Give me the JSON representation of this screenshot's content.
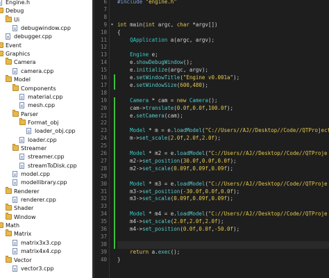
{
  "tree": {
    "items": [
      {
        "label": "Engine.h",
        "kind": "file"
      },
      {
        "label": "Debug",
        "kind": "folder"
      },
      {
        "label": "Ui",
        "kind": "folder"
      },
      {
        "label": "debugwindow.cpp",
        "kind": "file"
      },
      {
        "label": "debugger.cpp",
        "kind": "file"
      },
      {
        "label": "Event",
        "kind": "folder"
      },
      {
        "label": "Graphics",
        "kind": "folder"
      },
      {
        "label": "Camera",
        "kind": "folder"
      },
      {
        "label": "camera.cpp",
        "kind": "file"
      },
      {
        "label": "Model",
        "kind": "folder"
      },
      {
        "label": "Components",
        "kind": "folder"
      },
      {
        "label": "material.cpp",
        "kind": "file"
      },
      {
        "label": "mesh.cpp",
        "kind": "file"
      },
      {
        "label": "Parser",
        "kind": "folder"
      },
      {
        "label": "Format_obj",
        "kind": "folder"
      },
      {
        "label": "loader_obj.cpp",
        "kind": "file"
      },
      {
        "label": "loader.cpp",
        "kind": "file"
      },
      {
        "label": "Streamer",
        "kind": "folder"
      },
      {
        "label": "streamer.cpp",
        "kind": "file"
      },
      {
        "label": "streamToDisk.cpp",
        "kind": "file"
      },
      {
        "label": "model.cpp",
        "kind": "file"
      },
      {
        "label": "modellibrary.cpp",
        "kind": "file"
      },
      {
        "label": "Renderer",
        "kind": "folder"
      },
      {
        "label": "renderer.cpp",
        "kind": "file"
      },
      {
        "label": "Shader",
        "kind": "folder"
      },
      {
        "label": "Window",
        "kind": "folder"
      },
      {
        "label": "Math",
        "kind": "folder"
      },
      {
        "label": "Matrix",
        "kind": "folder"
      },
      {
        "label": "matrix3x3.cpp",
        "kind": "file"
      },
      {
        "label": "matrix4x4.cpp",
        "kind": "file"
      },
      {
        "label": "Vector",
        "kind": "folder"
      },
      {
        "label": "vector3.cpp",
        "kind": "file"
      }
    ]
  },
  "editor": {
    "line_numbers": [
      "6",
      "7",
      "8",
      "9",
      "10",
      "11",
      "12",
      "13",
      "14",
      "15",
      "16",
      "17",
      "18",
      "19",
      "20",
      "21",
      "22",
      "23",
      "24",
      "25",
      "26",
      "27",
      "28",
      "29",
      "30",
      "31",
      "32",
      "33",
      "34",
      "35",
      "36",
      "37",
      "38",
      "39",
      "40"
    ],
    "fold_marker": "▾",
    "lines": [
      [
        {
          "t": "#include ",
          "c": "pp"
        },
        {
          "t": "\"engine.h\"",
          "c": "str"
        }
      ],
      [],
      [],
      [
        {
          "t": "int ",
          "c": "kw"
        },
        {
          "t": "main(",
          "c": "id"
        },
        {
          "t": "int ",
          "c": "kw"
        },
        {
          "t": "argc, ",
          "c": "id"
        },
        {
          "t": "char ",
          "c": "kw"
        },
        {
          "t": "*argv[])",
          "c": "id"
        }
      ],
      [
        {
          "t": "{",
          "c": "id"
        }
      ],
      [
        {
          "t": "    ",
          "c": "id"
        },
        {
          "t": "QApplication",
          "c": "ty"
        },
        {
          "t": " a(argc, argv);",
          "c": "id"
        }
      ],
      [],
      [
        {
          "t": "    ",
          "c": "id"
        },
        {
          "t": "Engine",
          "c": "ty"
        },
        {
          "t": " e;",
          "c": "id"
        }
      ],
      [
        {
          "t": "    e.",
          "c": "id"
        },
        {
          "t": "showDebugWindow",
          "c": "fn"
        },
        {
          "t": "();",
          "c": "id"
        }
      ],
      [
        {
          "t": "    e.",
          "c": "id"
        },
        {
          "t": "initialize",
          "c": "fn"
        },
        {
          "t": "(argc, argv);",
          "c": "id"
        }
      ],
      [
        {
          "t": "    e.",
          "c": "id"
        },
        {
          "t": "setWindowTitle",
          "c": "fn"
        },
        {
          "t": "(",
          "c": "id"
        },
        {
          "t": "\"Engine v0.001a\"",
          "c": "str"
        },
        {
          "t": ");",
          "c": "id"
        }
      ],
      [
        {
          "t": "    e.",
          "c": "id"
        },
        {
          "t": "setWindowSize",
          "c": "fn"
        },
        {
          "t": "(",
          "c": "id"
        },
        {
          "t": "600",
          "c": "num"
        },
        {
          "t": ",",
          "c": "id"
        },
        {
          "t": "480",
          "c": "num"
        },
        {
          "t": ");",
          "c": "id"
        }
      ],
      [],
      [
        {
          "t": "    ",
          "c": "id"
        },
        {
          "t": "Camera",
          "c": "ty"
        },
        {
          "t": " * cam = ",
          "c": "id"
        },
        {
          "t": "new ",
          "c": "kw"
        },
        {
          "t": "Camera",
          "c": "ty"
        },
        {
          "t": "();",
          "c": "id"
        }
      ],
      [
        {
          "t": "    cam->",
          "c": "id"
        },
        {
          "t": "translate",
          "c": "fn"
        },
        {
          "t": "(",
          "c": "id"
        },
        {
          "t": "0.0f",
          "c": "num"
        },
        {
          "t": ",",
          "c": "id"
        },
        {
          "t": "0.0f",
          "c": "num"
        },
        {
          "t": ",",
          "c": "id"
        },
        {
          "t": "100.0f",
          "c": "num"
        },
        {
          "t": ");",
          "c": "id"
        }
      ],
      [
        {
          "t": "    e.",
          "c": "id"
        },
        {
          "t": "setCamera",
          "c": "fn"
        },
        {
          "t": "(cam);",
          "c": "id"
        }
      ],
      [],
      [
        {
          "t": "    ",
          "c": "id"
        },
        {
          "t": "Model",
          "c": "ty"
        },
        {
          "t": " * m = e.",
          "c": "id"
        },
        {
          "t": "loadModel",
          "c": "fn"
        },
        {
          "t": "(",
          "c": "id"
        },
        {
          "t": "\"C://Users//AJ//Desktop//Code//QTProjects",
          "c": "str"
        }
      ],
      [
        {
          "t": "    m->",
          "c": "id"
        },
        {
          "t": "set_scale",
          "c": "fn"
        },
        {
          "t": "(",
          "c": "id"
        },
        {
          "t": "2.0f",
          "c": "num"
        },
        {
          "t": ",",
          "c": "id"
        },
        {
          "t": "2.0f",
          "c": "num"
        },
        {
          "t": ",",
          "c": "id"
        },
        {
          "t": "2.0f",
          "c": "num"
        },
        {
          "t": ");",
          "c": "id"
        }
      ],
      [],
      [
        {
          "t": "    ",
          "c": "id"
        },
        {
          "t": "Model",
          "c": "ty"
        },
        {
          "t": " * m2 = e.",
          "c": "id"
        },
        {
          "t": "loadModel",
          "c": "fn"
        },
        {
          "t": "(",
          "c": "id"
        },
        {
          "t": "\"C://Users//AJ//Desktop//Code//QTProje",
          "c": "str"
        }
      ],
      [
        {
          "t": "    m2->",
          "c": "id"
        },
        {
          "t": "set_position",
          "c": "fn"
        },
        {
          "t": "(",
          "c": "id"
        },
        {
          "t": "30.0f",
          "c": "num"
        },
        {
          "t": ",",
          "c": "id"
        },
        {
          "t": "0.0f",
          "c": "num"
        },
        {
          "t": ",",
          "c": "id"
        },
        {
          "t": "0.0f",
          "c": "num"
        },
        {
          "t": ");",
          "c": "id"
        }
      ],
      [
        {
          "t": "    m2->",
          "c": "id"
        },
        {
          "t": "set_scale",
          "c": "fn"
        },
        {
          "t": "(",
          "c": "id"
        },
        {
          "t": "0.09f",
          "c": "num"
        },
        {
          "t": ",",
          "c": "id"
        },
        {
          "t": "0.09f",
          "c": "num"
        },
        {
          "t": ",",
          "c": "id"
        },
        {
          "t": "0.09f",
          "c": "num"
        },
        {
          "t": ");",
          "c": "id"
        }
      ],
      [],
      [
        {
          "t": "    ",
          "c": "id"
        },
        {
          "t": "Model",
          "c": "ty"
        },
        {
          "t": " * m3 = e.",
          "c": "id"
        },
        {
          "t": "loadModel",
          "c": "fn"
        },
        {
          "t": "(",
          "c": "id"
        },
        {
          "t": "\"C://Users//AJ//Desktop//Code//QTProje",
          "c": "str"
        }
      ],
      [
        {
          "t": "    m3->",
          "c": "id"
        },
        {
          "t": "set_position",
          "c": "fn"
        },
        {
          "t": "(",
          "c": "id"
        },
        {
          "t": "-30.0f",
          "c": "num"
        },
        {
          "t": ",",
          "c": "id"
        },
        {
          "t": "0.0f",
          "c": "num"
        },
        {
          "t": ",",
          "c": "id"
        },
        {
          "t": "0.0f",
          "c": "num"
        },
        {
          "t": ");",
          "c": "id"
        }
      ],
      [
        {
          "t": "    m3->",
          "c": "id"
        },
        {
          "t": "set_scale",
          "c": "fn"
        },
        {
          "t": "(",
          "c": "id"
        },
        {
          "t": "0.09f",
          "c": "num"
        },
        {
          "t": ",",
          "c": "id"
        },
        {
          "t": "0.09f",
          "c": "num"
        },
        {
          "t": ",",
          "c": "id"
        },
        {
          "t": "0.09f",
          "c": "num"
        },
        {
          "t": ");",
          "c": "id"
        }
      ],
      [],
      [
        {
          "t": "    ",
          "c": "id"
        },
        {
          "t": "Model",
          "c": "ty"
        },
        {
          "t": " * m4 = e.",
          "c": "id"
        },
        {
          "t": "loadModel",
          "c": "fn"
        },
        {
          "t": "(",
          "c": "id"
        },
        {
          "t": "\"C://Users//AJ//Desktop//Code//QTProje",
          "c": "str"
        }
      ],
      [
        {
          "t": "    m4->",
          "c": "id"
        },
        {
          "t": "set_scale",
          "c": "fn"
        },
        {
          "t": "(",
          "c": "id"
        },
        {
          "t": "2.0f",
          "c": "num"
        },
        {
          "t": ",",
          "c": "id"
        },
        {
          "t": "2.0f",
          "c": "num"
        },
        {
          "t": ",",
          "c": "id"
        },
        {
          "t": "2.0f",
          "c": "num"
        },
        {
          "t": ");",
          "c": "id"
        }
      ],
      [
        {
          "t": "    m4->",
          "c": "id"
        },
        {
          "t": "set_position",
          "c": "fn"
        },
        {
          "t": "(",
          "c": "id"
        },
        {
          "t": "0.0f",
          "c": "num"
        },
        {
          "t": ",",
          "c": "id"
        },
        {
          "t": "0.0f",
          "c": "num"
        },
        {
          "t": ",",
          "c": "id"
        },
        {
          "t": "-50.0f",
          "c": "num"
        },
        {
          "t": ");",
          "c": "id"
        }
      ],
      [],
      [],
      [
        {
          "t": "    ",
          "c": "id"
        },
        {
          "t": "return ",
          "c": "kw"
        },
        {
          "t": "a.",
          "c": "id"
        },
        {
          "t": "exec",
          "c": "fn"
        },
        {
          "t": "();",
          "c": "id"
        }
      ],
      [
        {
          "t": "}",
          "c": "id"
        }
      ]
    ]
  },
  "colors": {
    "editor_bg": "#1e1e1e",
    "tree_bg": "#ffffff",
    "keyword": "#e6c84a",
    "type": "#3ec9c9",
    "string": "#e6c84a",
    "change_marker": "#3fbf3f"
  }
}
